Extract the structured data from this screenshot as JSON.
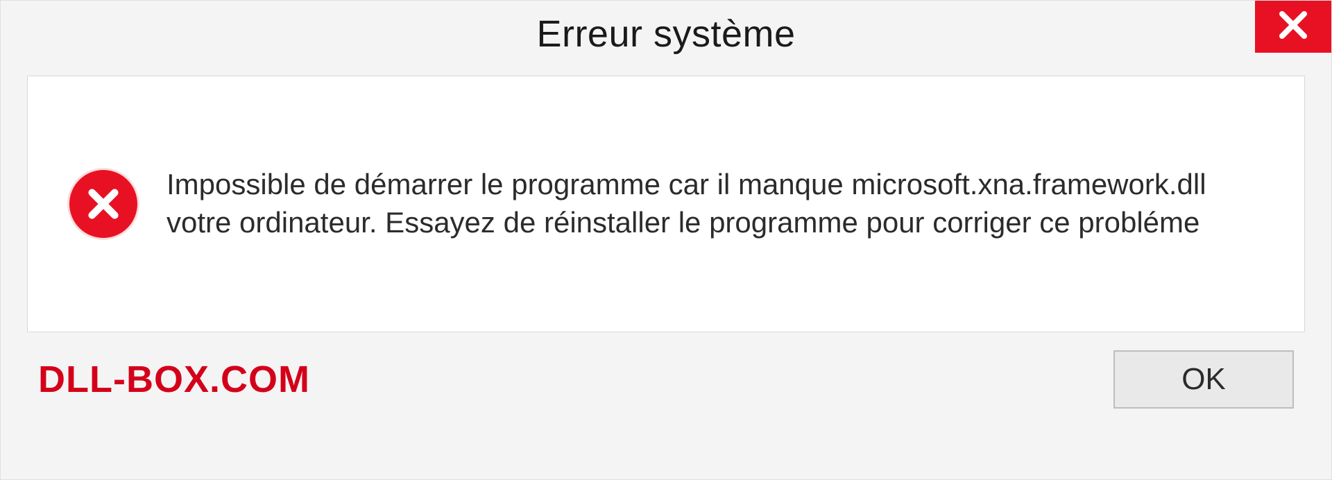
{
  "dialog": {
    "title": "Erreur système",
    "message": "Impossible de démarrer le programme car il manque microsoft.xna.framework.dll votre ordinateur. Essayez de réinstaller le programme pour corriger ce probléme",
    "ok_label": "OK",
    "brand": "DLL-BOX.COM",
    "icons": {
      "close": "close-icon",
      "error": "error-icon"
    },
    "colors": {
      "accent_red": "#e81123",
      "brand_red": "#d4001a",
      "background": "#f4f4f4",
      "content_bg": "#ffffff"
    }
  }
}
